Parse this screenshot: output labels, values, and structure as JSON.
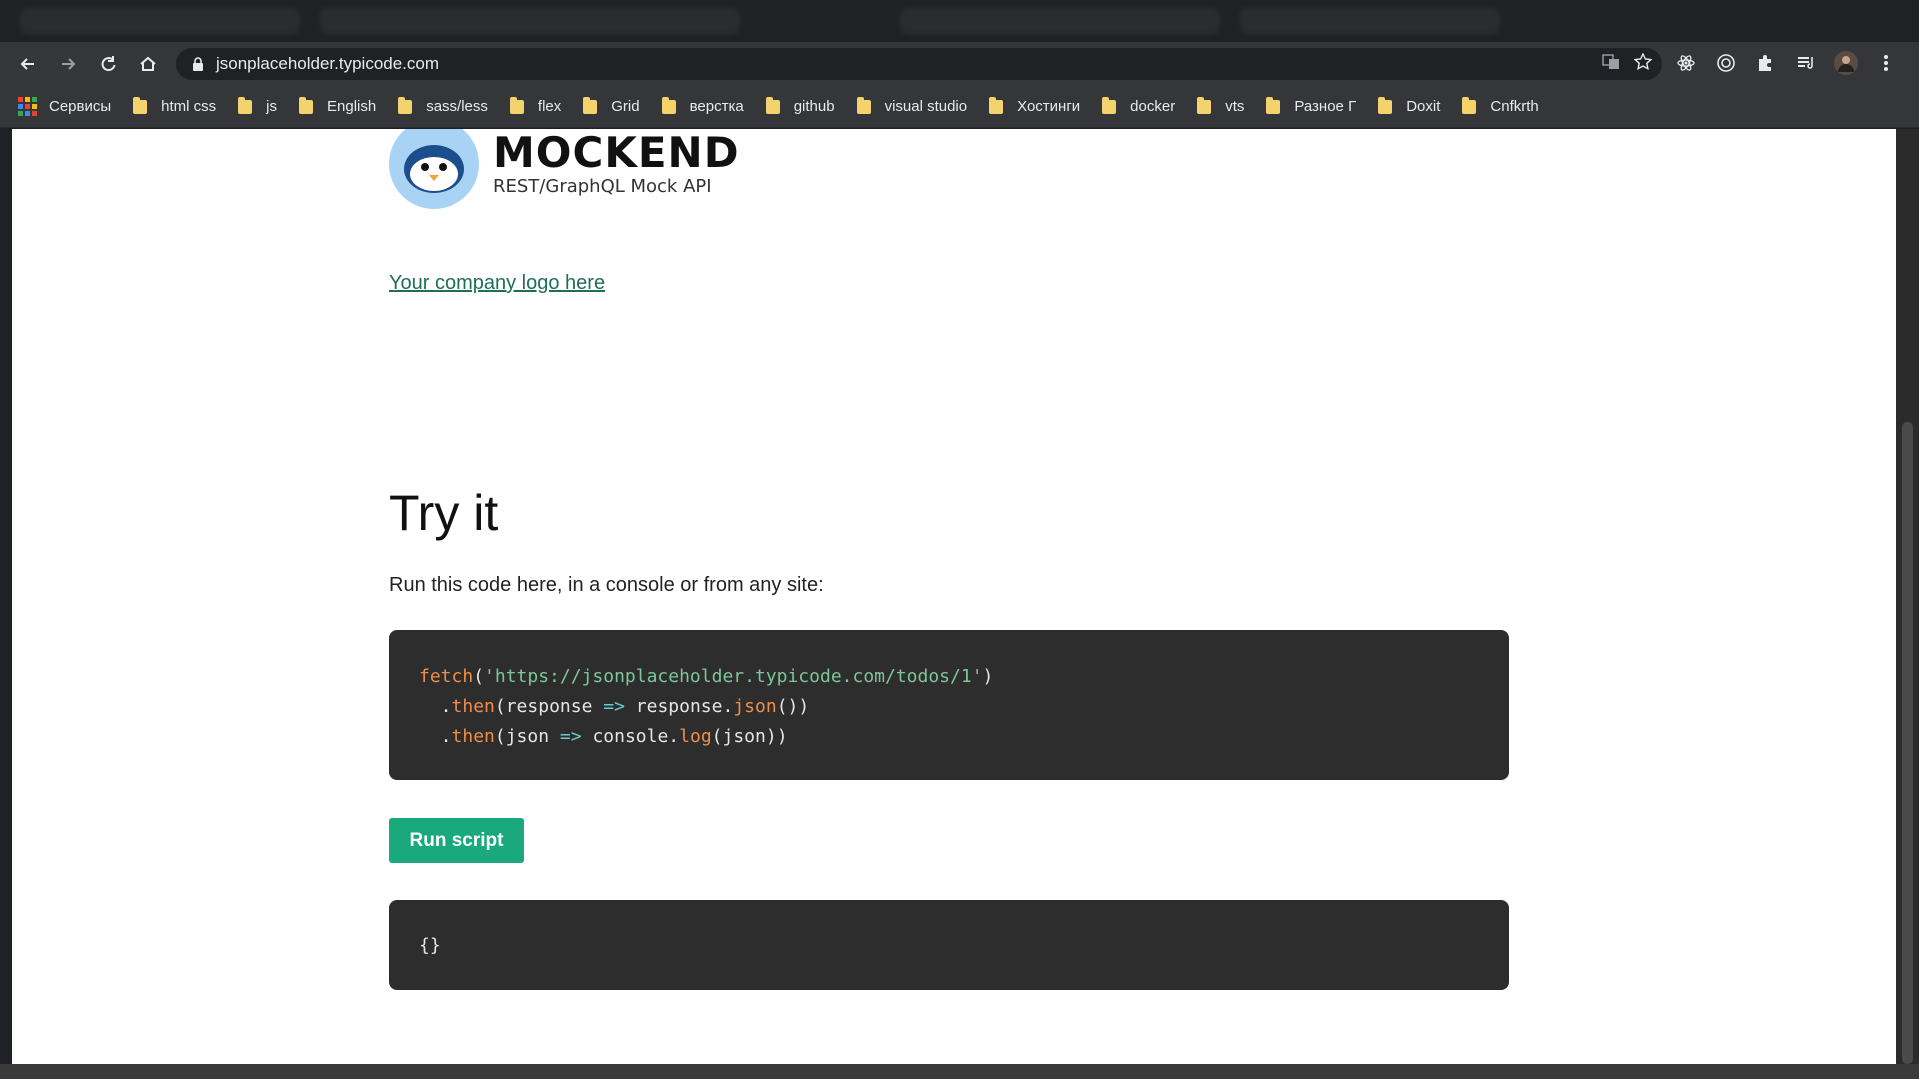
{
  "browser": {
    "url": "jsonplaceholder.typicode.com",
    "bookmarks": [
      {
        "label": "Сервисы",
        "type": "apps"
      },
      {
        "label": "html css",
        "type": "folder"
      },
      {
        "label": "js",
        "type": "folder"
      },
      {
        "label": "English",
        "type": "folder"
      },
      {
        "label": "sass/less",
        "type": "folder"
      },
      {
        "label": "flex",
        "type": "folder"
      },
      {
        "label": "Grid",
        "type": "folder"
      },
      {
        "label": "верстка",
        "type": "folder"
      },
      {
        "label": "github",
        "type": "folder"
      },
      {
        "label": "visual studio",
        "type": "folder"
      },
      {
        "label": "Хостинги",
        "type": "folder"
      },
      {
        "label": "docker",
        "type": "folder"
      },
      {
        "label": "vts",
        "type": "folder"
      },
      {
        "label": "Разное Г",
        "type": "folder"
      },
      {
        "label": "Doxit",
        "type": "folder"
      },
      {
        "label": "Cnfkrth",
        "type": "folder"
      }
    ]
  },
  "page": {
    "brand": {
      "title": "MOCKEND",
      "subtitle": "REST/GraphQL Mock API"
    },
    "company_link": "Your company logo here",
    "heading": "Try it",
    "lead": "Run this code here, in a console or from any site:",
    "code": {
      "fn": "fetch",
      "url": "'https://jsonplaceholder.typicode.com/todos/1'",
      "line2_method": "then",
      "line2_arg": "response",
      "line2_obj": "response",
      "line2_call": "json",
      "line3_method": "then",
      "line3_arg": "json",
      "line3_obj": "console",
      "line3_call": "log",
      "line3_param": "json"
    },
    "run_button": "Run script",
    "result": "{}"
  },
  "colors": {
    "accent": "#1aa97b",
    "link": "#1f6e58",
    "code_bg": "#2d2d2d"
  }
}
